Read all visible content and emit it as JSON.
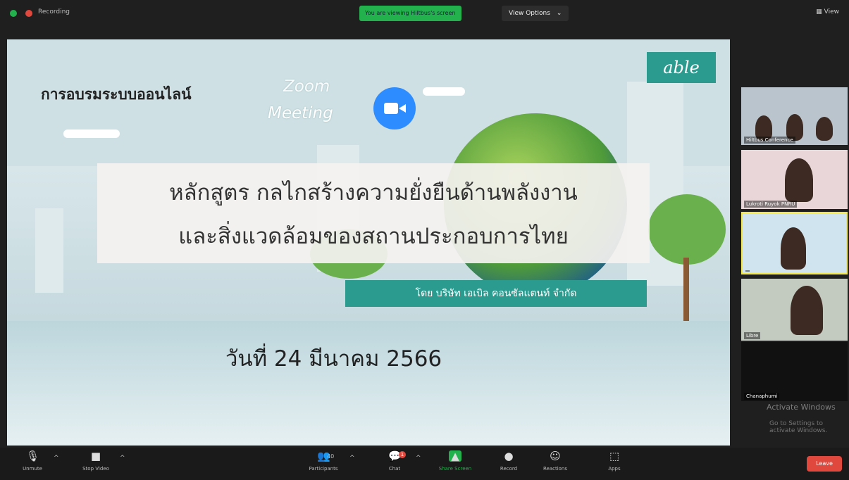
{
  "topbar": {
    "recording_label": "Recording",
    "share_notice": "You are viewing Hiltbus's screen",
    "view_options_label": "View Options",
    "view_options_caret": "⌄",
    "view_label": "View"
  },
  "slide": {
    "logo_text": "able",
    "online_training": "การอบรมระบบออนไลน์",
    "zoom_word": "Zoom",
    "meeting_word": "Meeting",
    "course_line1": "หลักสูตร กลไกสร้างความยั่งยืนด้านพลังงาน",
    "course_line2": "และสิ่งแวดล้อมของสถานประกอบการไทย",
    "company": "โดย บริษัท เอเบิล คอนซัลแตนท์ จำกัด",
    "date": "วันที่ 24 มีนาคม 2566"
  },
  "participants": [
    {
      "name": "Hiltbus Conference"
    },
    {
      "name": "Lukroti Ruyok PNRU"
    },
    {
      "name": ""
    },
    {
      "name": "Libre"
    },
    {
      "name": "Chanaphumi"
    }
  ],
  "watermark": {
    "line1": "Activate Windows",
    "line2": "Go to Settings to activate Windows."
  },
  "toolbar": {
    "unmute": "Unmute",
    "stop_video": "Stop Video",
    "participants": "Participants",
    "participants_count": "40",
    "chat": "Chat",
    "chat_badge": "1",
    "share_screen": "Share Screen",
    "record": "Record",
    "reactions": "Reactions",
    "apps": "Apps",
    "leave": "Leave"
  },
  "colors": {
    "accent_green": "#23b14d",
    "leave_red": "#e0483e",
    "able_teal": "#2a9b8e",
    "zoom_blue": "#2d8cff"
  }
}
